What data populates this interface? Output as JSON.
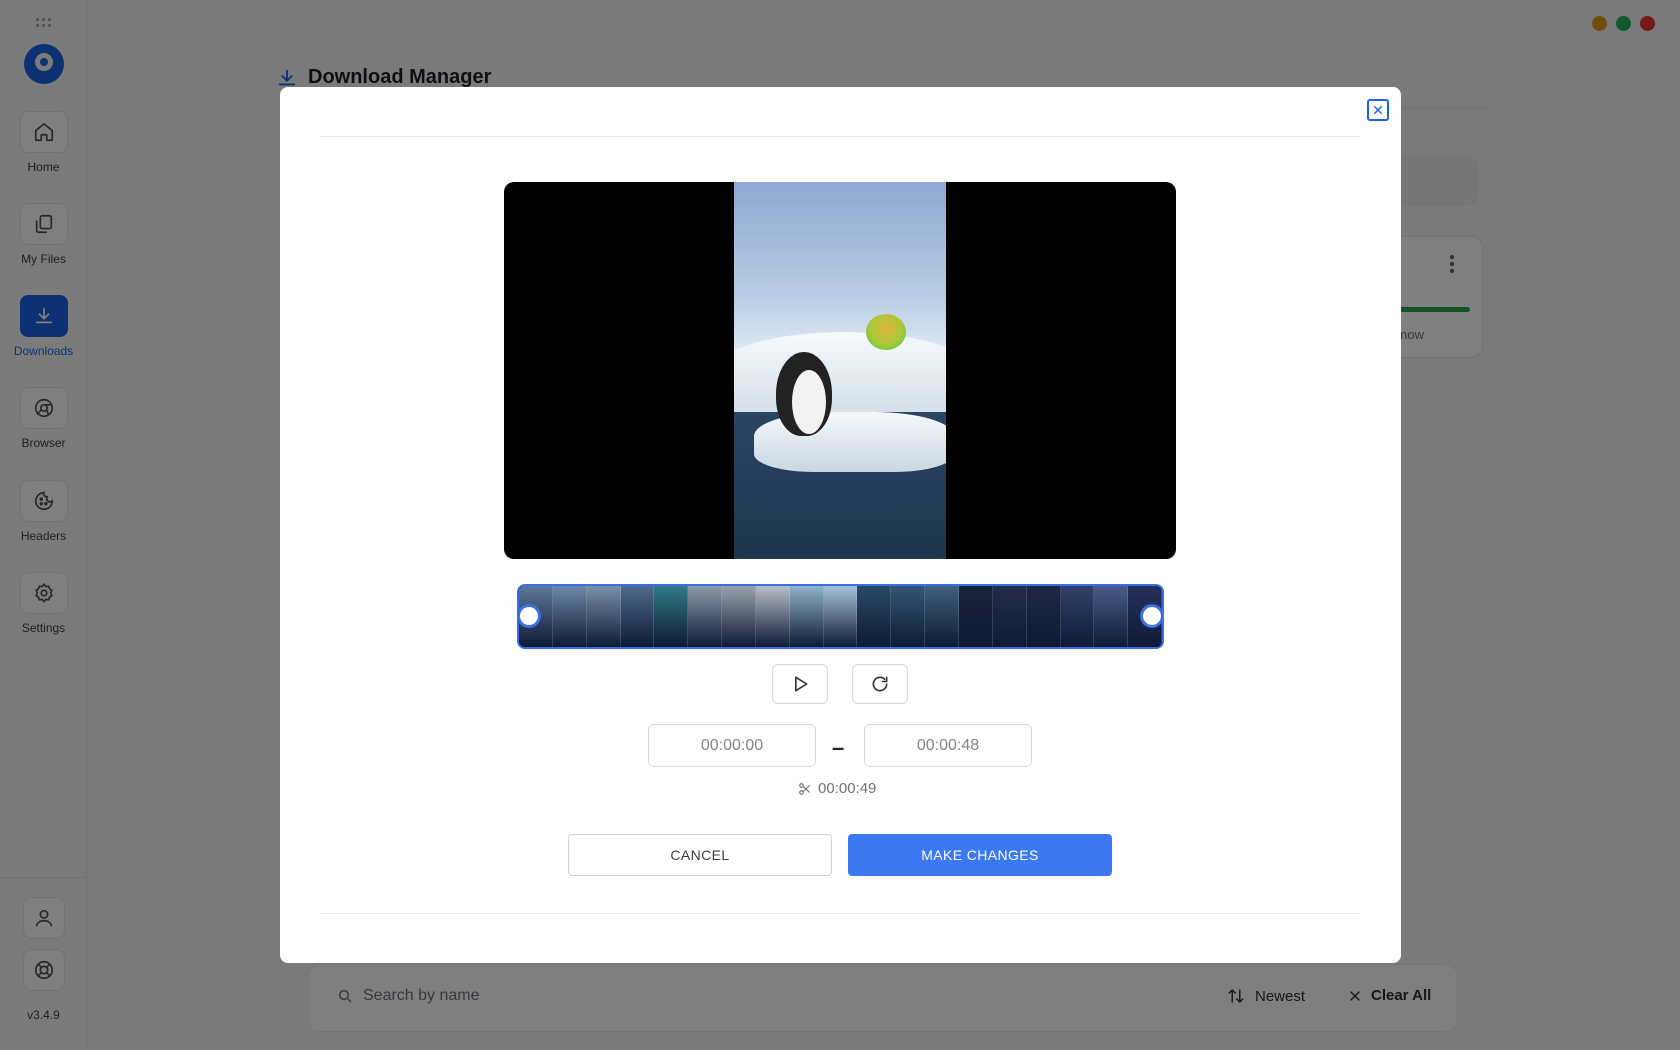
{
  "app": {
    "version": "v3.4.9",
    "window_dots": [
      "#e29b12",
      "#1fb25a",
      "#e5362f"
    ]
  },
  "sidebar": {
    "items": [
      {
        "label": "Home",
        "icon": "home-icon",
        "active": false
      },
      {
        "label": "My Files",
        "icon": "files-icon",
        "active": false
      },
      {
        "label": "Downloads",
        "icon": "download-icon",
        "active": true
      },
      {
        "label": "Browser",
        "icon": "browser-icon",
        "active": false
      },
      {
        "label": "Headers",
        "icon": "cookie-icon",
        "active": false
      },
      {
        "label": "Settings",
        "icon": "gear-icon",
        "active": false
      }
    ],
    "bottom": [
      {
        "icon": "user-icon"
      },
      {
        "icon": "lifebuoy-icon"
      }
    ]
  },
  "main": {
    "title": "Download Manager",
    "card": {
      "time": "now"
    },
    "search": {
      "placeholder": "Search by name"
    },
    "sort_label": "Newest",
    "clear_label": "Clear All"
  },
  "modal": {
    "start_time": "00:00:00",
    "end_time": "00:00:48",
    "separator": "–",
    "duration": "00:00:49",
    "cancel_label": "CANCEL",
    "confirm_label": "MAKE CHANGES",
    "trim_start_fraction": 0.0,
    "trim_end_fraction": 1.0
  },
  "colors": {
    "accent": "#1d63e8",
    "primary_button": "#3b78f2",
    "progress": "#22a34a"
  }
}
